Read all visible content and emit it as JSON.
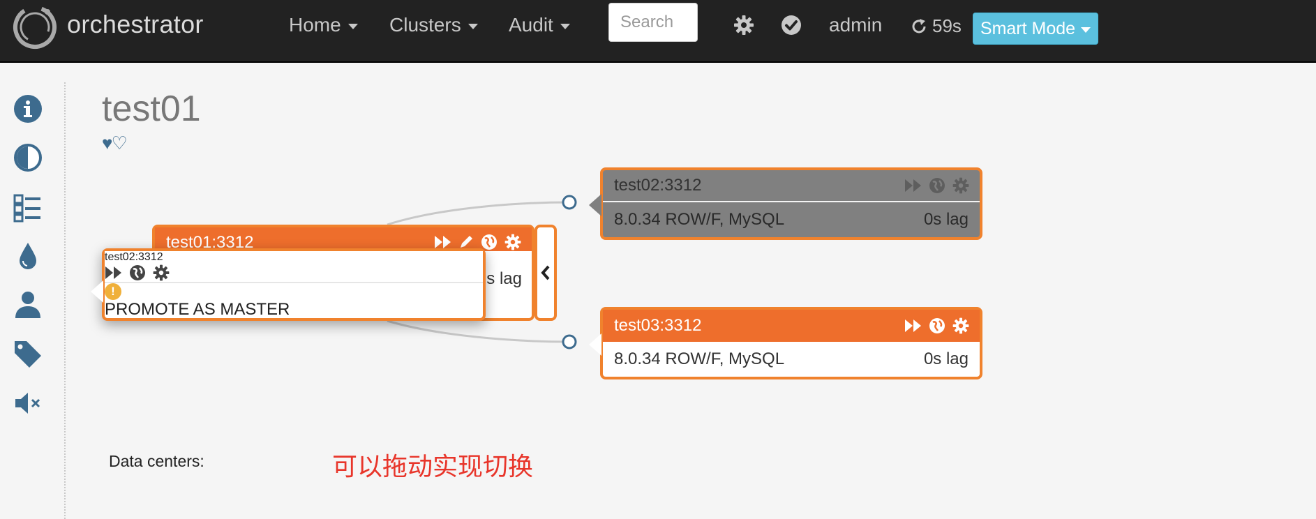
{
  "navbar": {
    "brand": "orchestrator",
    "menus": [
      {
        "label": "Home"
      },
      {
        "label": "Clusters"
      },
      {
        "label": "Audit"
      }
    ],
    "search_placeholder": "Search",
    "user": "admin",
    "refresh_countdown": "59s",
    "smart_mode_label": "Smart Mode"
  },
  "sidebar": {
    "icons": [
      "info-icon",
      "contrast-icon",
      "tasks-icon",
      "tint-icon",
      "user-icon",
      "tag-icon",
      "volume-off-icon"
    ]
  },
  "cluster": {
    "title": "test01",
    "hearts": "♥♡"
  },
  "instances": {
    "test01": {
      "name": "test01:3312",
      "lag": "s lag"
    },
    "test02": {
      "name": "test02:3312",
      "version": "8.0.34 ROW/F, MySQL",
      "lag": "0s lag"
    },
    "test03": {
      "name": "test03:3312",
      "version": "8.0.34 ROW/F, MySQL",
      "lag": "0s lag"
    }
  },
  "drag": {
    "name": "test02:3312",
    "action": "PROMOTE AS MASTER",
    "warn_glyph": "!"
  },
  "data_centers_label": "Data centers:",
  "annotation": "可以拖动实现切换",
  "colors": {
    "navbar_bg": "#222222",
    "instance_orange": "#ee6e2c",
    "smart_mode_bg": "#5bc0de",
    "annotation_red": "#e8352a",
    "sidebar_icon": "#3d6b8e"
  }
}
